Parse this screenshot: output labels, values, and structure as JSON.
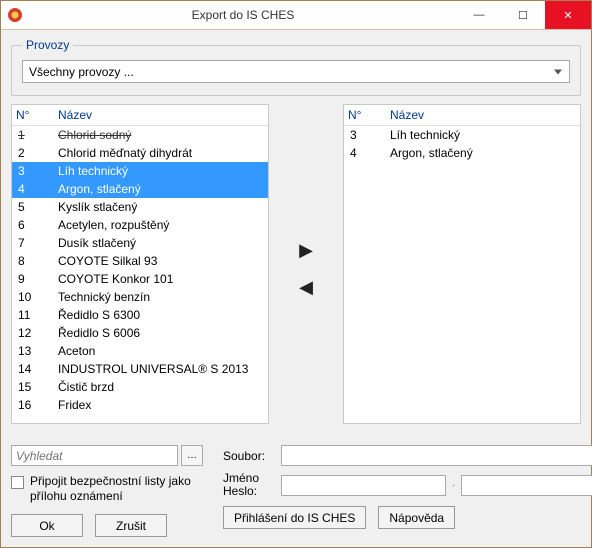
{
  "window": {
    "title": "Export do IS CHES"
  },
  "provozy": {
    "legend": "Provozy",
    "selected": "Všechny provozy ..."
  },
  "left_table": {
    "headers": {
      "num": "N°",
      "name": "Název"
    },
    "rows": [
      {
        "num": "1",
        "name": "Chlorid sodný",
        "strike": true
      },
      {
        "num": "2",
        "name": "Chlorid měďnatý dihydrát"
      },
      {
        "num": "3",
        "name": "Líh technický",
        "selected": true
      },
      {
        "num": "4",
        "name": "Argon, stlačený",
        "selected": true
      },
      {
        "num": "5",
        "name": "Kyslík stlačený"
      },
      {
        "num": "6",
        "name": "Acetylen, rozpuštěný"
      },
      {
        "num": "7",
        "name": "Dusík stlačený"
      },
      {
        "num": "8",
        "name": "COYOTE Silkal 93"
      },
      {
        "num": "9",
        "name": "COYOTE Konkor 101"
      },
      {
        "num": "10",
        "name": "Technický benzín"
      },
      {
        "num": "11",
        "name": "Ředidlo S 6300"
      },
      {
        "num": "12",
        "name": "Ředidlo S 6006"
      },
      {
        "num": "13",
        "name": "Aceton"
      },
      {
        "num": "14",
        "name": "INDUSTROL UNIVERSAL® S 2013"
      },
      {
        "num": "15",
        "name": "Čistič brzd"
      },
      {
        "num": "16",
        "name": "Fridex"
      }
    ]
  },
  "right_table": {
    "headers": {
      "num": "N°",
      "name": "Název"
    },
    "rows": [
      {
        "num": "3",
        "name": "Líh technický"
      },
      {
        "num": "4",
        "name": "Argon, stlačený"
      }
    ]
  },
  "search": {
    "placeholder": "Vyhledat",
    "browse_glyph": "…"
  },
  "checkbox": {
    "label": "Připojit bezpečnostní listy jako přílohu oznámení"
  },
  "buttons": {
    "ok": "Ok",
    "cancel": "Zrušit",
    "login": "Přihlášení do IS CHES",
    "help": "Nápověda"
  },
  "labels": {
    "file": "Soubor:",
    "credentials": "Jméno Heslo:"
  },
  "credentials": {
    "username": "",
    "password": "",
    "separator": "·"
  },
  "file_value": ""
}
